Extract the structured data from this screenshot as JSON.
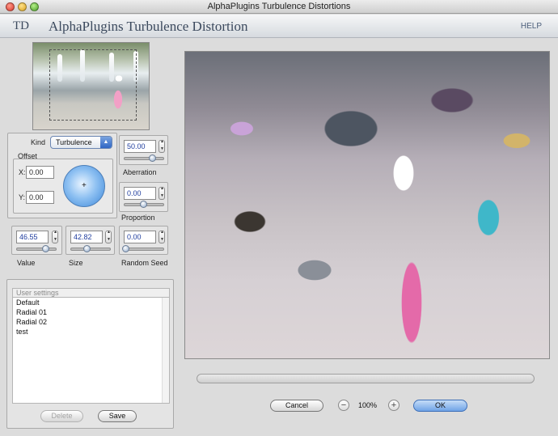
{
  "window": {
    "title": "AlphaPlugins Turbulence Distortions"
  },
  "banner": {
    "logo": "TD",
    "name": "AlphaPlugins Turbulence Distortion",
    "help": "HELP"
  },
  "controls": {
    "kind_label": "Kind",
    "kind_value": "Turbulence",
    "offset_label": "Offset",
    "x_label": "X:",
    "x_value": "0.00",
    "y_label": "Y:",
    "y_value": "0.00",
    "aberration_value": "50.00",
    "aberration_label": "Aberration",
    "proportion_value": "0.00",
    "proportion_label": "Proportion",
    "value_value": "46.55",
    "value_label": "Value",
    "size_value": "42.82",
    "size_label": "Size",
    "seed_value": "0.00",
    "seed_label": "Random Seed"
  },
  "settings": {
    "header": "User settings",
    "items": [
      "Default",
      "Radial 01",
      "Radial 02",
      "test"
    ],
    "delete_label": "Delete",
    "save_label": "Save"
  },
  "footer": {
    "cancel_label": "Cancel",
    "zoom_out": "−",
    "zoom_level": "100%",
    "zoom_in": "+",
    "ok_label": "OK"
  }
}
